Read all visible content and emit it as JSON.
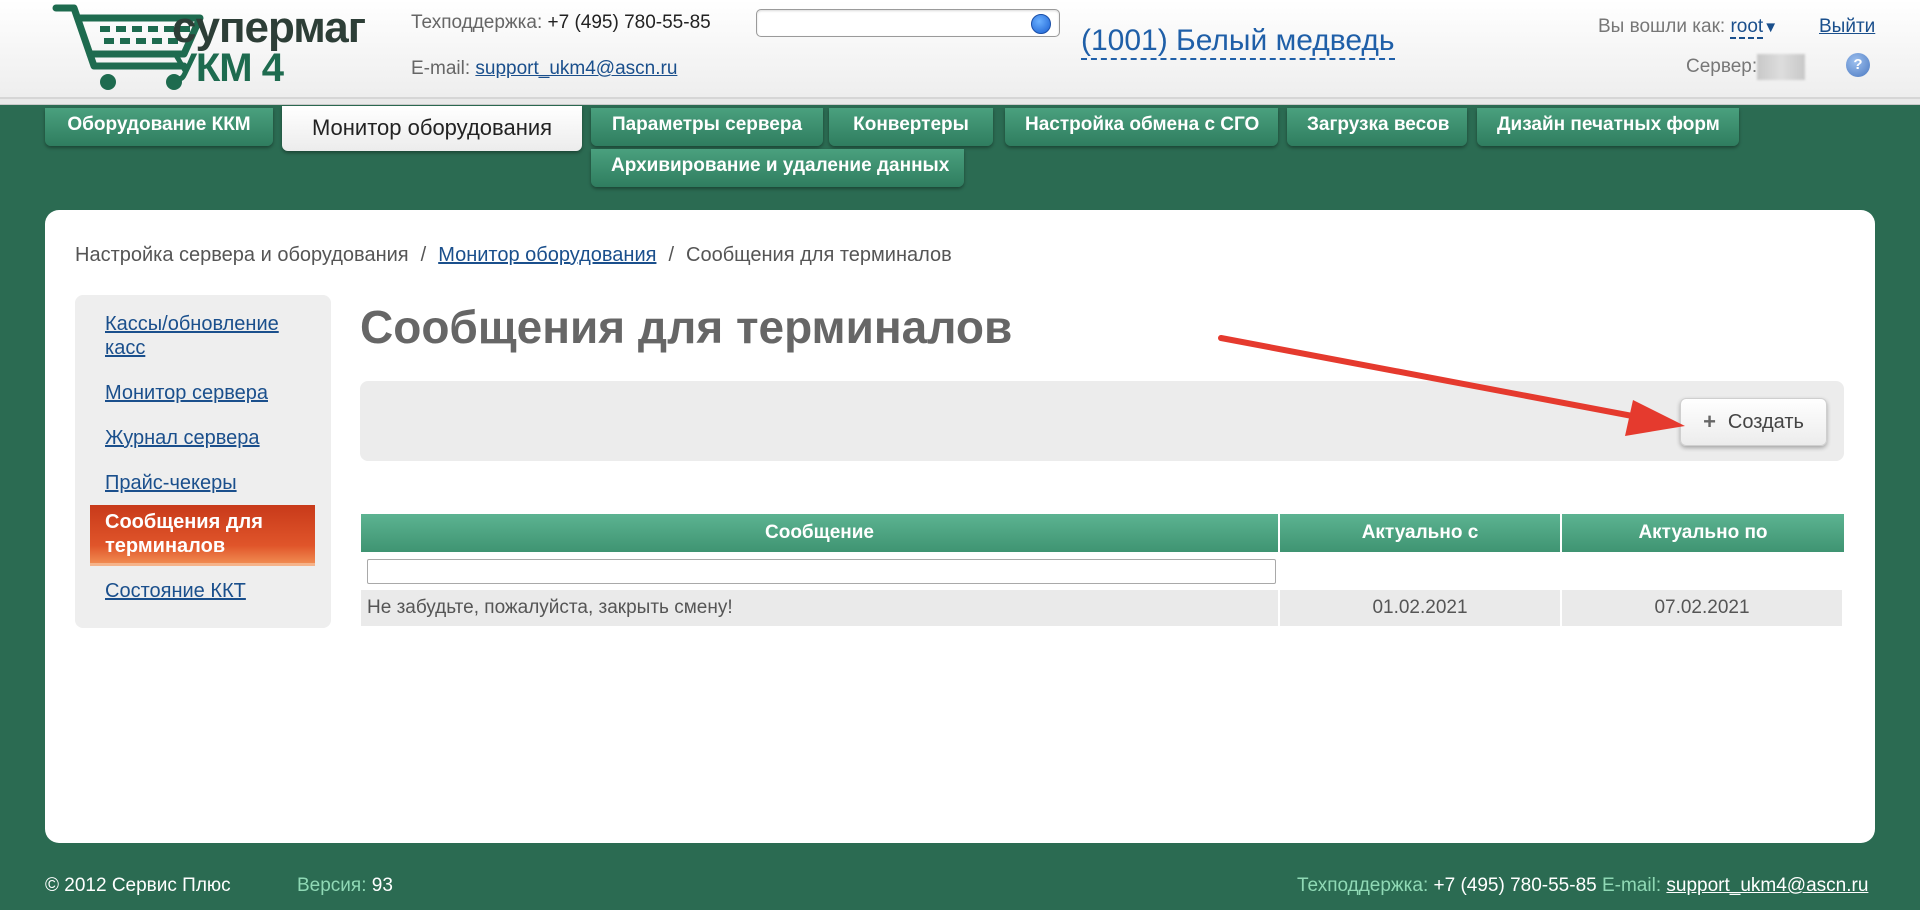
{
  "colors": {
    "background": "#2b6b52",
    "tab": "#2f7d5f",
    "accent_active": "#d84a1f",
    "table_header": "#4fa380",
    "link": "#1a4f8c"
  },
  "logo": {
    "line1": "супермаг",
    "line2": "УКМ 4",
    "icon": "shopping-cart-icon"
  },
  "header": {
    "support_label": "Техподдержка:",
    "support_phone": "+7 (495) 780-55-85",
    "email_label": "E-mail:",
    "email": "support_ukm4@ascn.ru",
    "search_placeholder": "",
    "store": "(1001) Белый медведь",
    "logged_label": "Вы вошли как:",
    "user": "root",
    "logout": "Выйти",
    "server_label": "Сервер:",
    "help": "?"
  },
  "tabs": [
    {
      "label": "Оборудование ККМ"
    },
    {
      "label": "Монитор оборудования",
      "active": true
    },
    {
      "label": "Параметры сервера"
    },
    {
      "label": "Конвертеры"
    },
    {
      "label": "Настройка обмена с СГО"
    },
    {
      "label": "Загрузка весов"
    },
    {
      "label": "Дизайн печатных форм"
    },
    {
      "label": "Архивирование и удаление данных"
    }
  ],
  "breadcrumb": {
    "root": "Настройка сервера и оборудования",
    "sep": "/",
    "parent": "Монитор оборудования",
    "current": "Сообщения для терминалов"
  },
  "sidebar": {
    "items": [
      {
        "label": "Кассы/обновление касс"
      },
      {
        "label": "Монитор сервера"
      },
      {
        "label": "Журнал сервера"
      },
      {
        "label": "Прайс-чекеры"
      },
      {
        "label": "Сообщения для терминалов",
        "active": true
      },
      {
        "label": "Состояние ККТ"
      }
    ]
  },
  "main": {
    "title": "Сообщения для терминалов",
    "create_plus": "+",
    "create_label": "Создать"
  },
  "table": {
    "columns": [
      "Сообщение",
      "Актуально с",
      "Актуально по"
    ],
    "rows": [
      [
        "Не забудьте, пожалуйста, закрыть смену!",
        "01.02.2021",
        "07.02.2021"
      ]
    ]
  },
  "footer": {
    "copyright": "© 2012 Сервис Плюс",
    "version_label": "Версия:",
    "version": "93",
    "support_label": "Техподдержка:",
    "support_phone": "+7 (495) 780-55-85",
    "email_label": "E-mail:",
    "email": "support_ukm4@ascn.ru"
  }
}
